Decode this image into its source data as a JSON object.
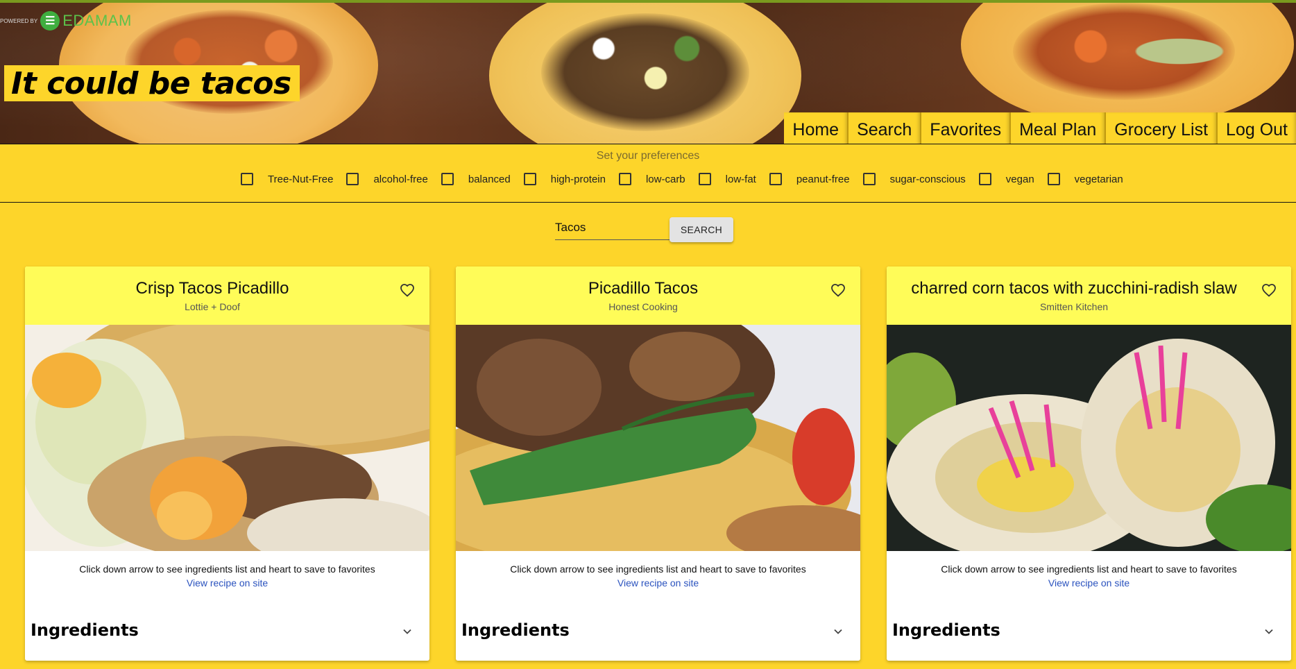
{
  "header": {
    "logo_text": "EDAMAM",
    "logo_powered": "POWERED BY",
    "title": "It could be tacos",
    "nav": [
      "Home",
      "Search",
      "Favorites",
      "Meal Plan",
      "Grocery List",
      "Log Out"
    ]
  },
  "preferences": {
    "title": "Set your preferences",
    "options": [
      "Tree-Nut-Free",
      "alcohol-free",
      "balanced",
      "high-protein",
      "low-carb",
      "low-fat",
      "peanut-free",
      "sugar-conscious",
      "vegan",
      "vegetarian"
    ]
  },
  "search": {
    "value": "Tacos",
    "button_label": "SEARCH"
  },
  "cards": [
    {
      "title": "Crisp Tacos Picadillo",
      "source": "Lottie + Doof",
      "note": "Click down arrow to see ingredients list and heart to save to favorites",
      "link": "View recipe on site",
      "section": "Ingredients"
    },
    {
      "title": "Picadillo Tacos",
      "source": "Honest Cooking",
      "note": "Click down arrow to see ingredients list and heart to save to favorites",
      "link": "View recipe on site",
      "section": "Ingredients"
    },
    {
      "title": "charred corn tacos with zucchini-radish slaw",
      "source": "Smitten Kitchen",
      "note": "Click down arrow to see ingredients list and heart to save to favorites",
      "link": "View recipe on site",
      "section": "Ingredients"
    }
  ],
  "colors": {
    "page_bg": "#FDD52A",
    "card_header": "#FFFC58",
    "link": "#2a52be",
    "edamam_green": "#3fae3f"
  },
  "icons": [
    "edamam-logo-icon",
    "heart-icon",
    "chevron-down-icon",
    "checkbox-icon"
  ]
}
